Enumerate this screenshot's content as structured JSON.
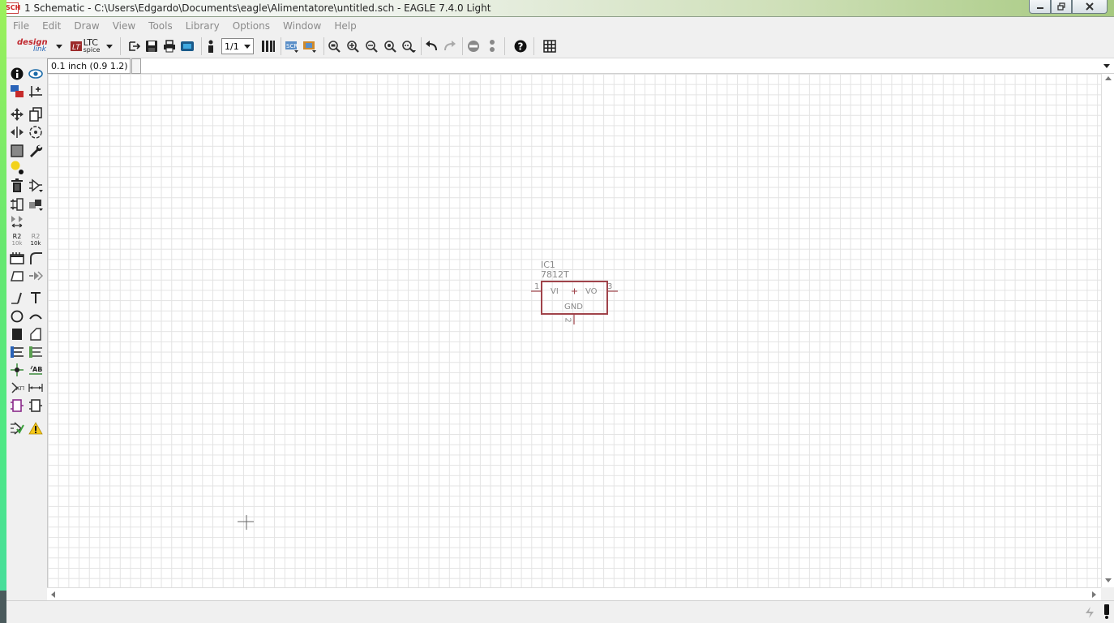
{
  "window": {
    "title": "1 Schematic - C:\\Users\\Edgardo\\Documents\\eagle\\Alimentatore\\untitled.sch - EAGLE 7.4.0 Light",
    "icon_label": "SCH"
  },
  "menu": {
    "items": [
      "File",
      "Edit",
      "Draw",
      "View",
      "Tools",
      "Library",
      "Options",
      "Window",
      "Help"
    ]
  },
  "toolbar": {
    "designlink_label": "design link",
    "ltc_label": "LTC",
    "spice_label": "spice",
    "sheet_select": "1/1"
  },
  "command_line": {
    "coordinate": "0.1 inch (0.9 1.2)",
    "value": ""
  },
  "left_tools": {
    "name_label_top": "R2",
    "name_label_bottom": "10k",
    "value_label_top": "R2",
    "value_label_bottom": "10k"
  },
  "schematic": {
    "part": {
      "name": "IC1",
      "value": "7812T",
      "pin_left_label": "VI",
      "pin_right_label": "VO",
      "pin_bottom_label": "GND",
      "pin_left_number": "1",
      "pin_right_number": "3",
      "pin_bottom_number": "2"
    },
    "colors": {
      "symbol": "#a0434a",
      "text": "#8a8a8a",
      "grid": "#e3e3e3"
    }
  },
  "status": {
    "text": ""
  }
}
